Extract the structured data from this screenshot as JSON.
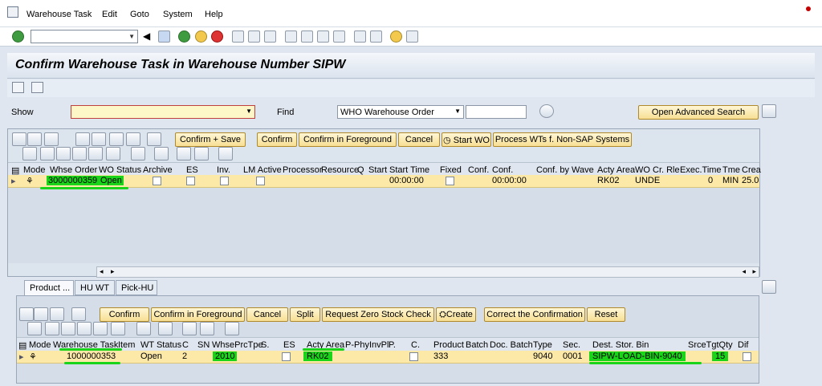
{
  "menubar": {
    "items": [
      "Warehouse Task",
      "Edit",
      "Goto",
      "System",
      "Help"
    ]
  },
  "toolbar": {
    "command_value": ""
  },
  "title": "Confirm Warehouse Task in Warehouse Number SIPW",
  "selection": {
    "show_label": "Show",
    "show_value": "",
    "find_label": "Find",
    "find_value": "WHO Warehouse Order",
    "find_input": "",
    "advanced_search_label": "Open Advanced Search"
  },
  "top_actions": [
    "Confirm + Save",
    "Confirm",
    "Confirm in Foreground",
    "Cancel",
    "Start WO",
    "Process WTs f. Non-SAP Systems"
  ],
  "top_grid": {
    "headers": [
      "Mode",
      "Whse Order",
      "WO Status",
      "Archive",
      "ES",
      "Inv.",
      "LM Active",
      "Processor",
      "Resource",
      "Q",
      "Start",
      "Start Time",
      "Fixed",
      "Conf.",
      "Conf.",
      "Conf. by",
      "Wave",
      "Acty Area",
      "WO Cr. Rle",
      "Exec.Time",
      "Tme",
      "Crea"
    ],
    "row": {
      "whse_order": "3000000359",
      "wo_status": "Open",
      "start_time": "00:00:00",
      "conf_time": "00:00:00",
      "acty_area": "RK02",
      "wo_cr_rle": "UNDE",
      "exec_time": "0",
      "tme": "MIN",
      "crea": "25.0"
    }
  },
  "tabs": [
    "Product ...",
    "HU WT",
    "Pick-HU"
  ],
  "bottom_actions": [
    "Confirm",
    "Confirm in Foreground",
    "Cancel",
    "Split",
    "Request Zero Stock Check",
    "Create",
    "Correct the Confirmation",
    "Reset"
  ],
  "bottom_grid": {
    "headers": [
      "Mode",
      "Warehouse Task",
      "Item",
      "WT Status",
      "C",
      "SN",
      "WhsePrcTpe",
      "S.",
      "ES",
      "Acty Area",
      "P-PhyInvPl",
      "P.",
      "C.",
      "Product",
      "Batch",
      "Doc. Batch",
      "Type",
      "Sec.",
      "Dest. Stor. Bin",
      "SrceTgtQty",
      "Dif"
    ],
    "row": {
      "warehouse_task": "1000000353",
      "wt_status": "Open",
      "c": "2",
      "whse_prc_tpe": "2010",
      "acty_area": "RK02",
      "product": "333",
      "type": "9040",
      "sec": "0001",
      "dest_bin": "SIPW-LOAD-BIN-9040",
      "qty": "15"
    }
  },
  "colors": {
    "highlight": "#19d419",
    "row": "#fde9a7",
    "button": "#f7df94"
  }
}
